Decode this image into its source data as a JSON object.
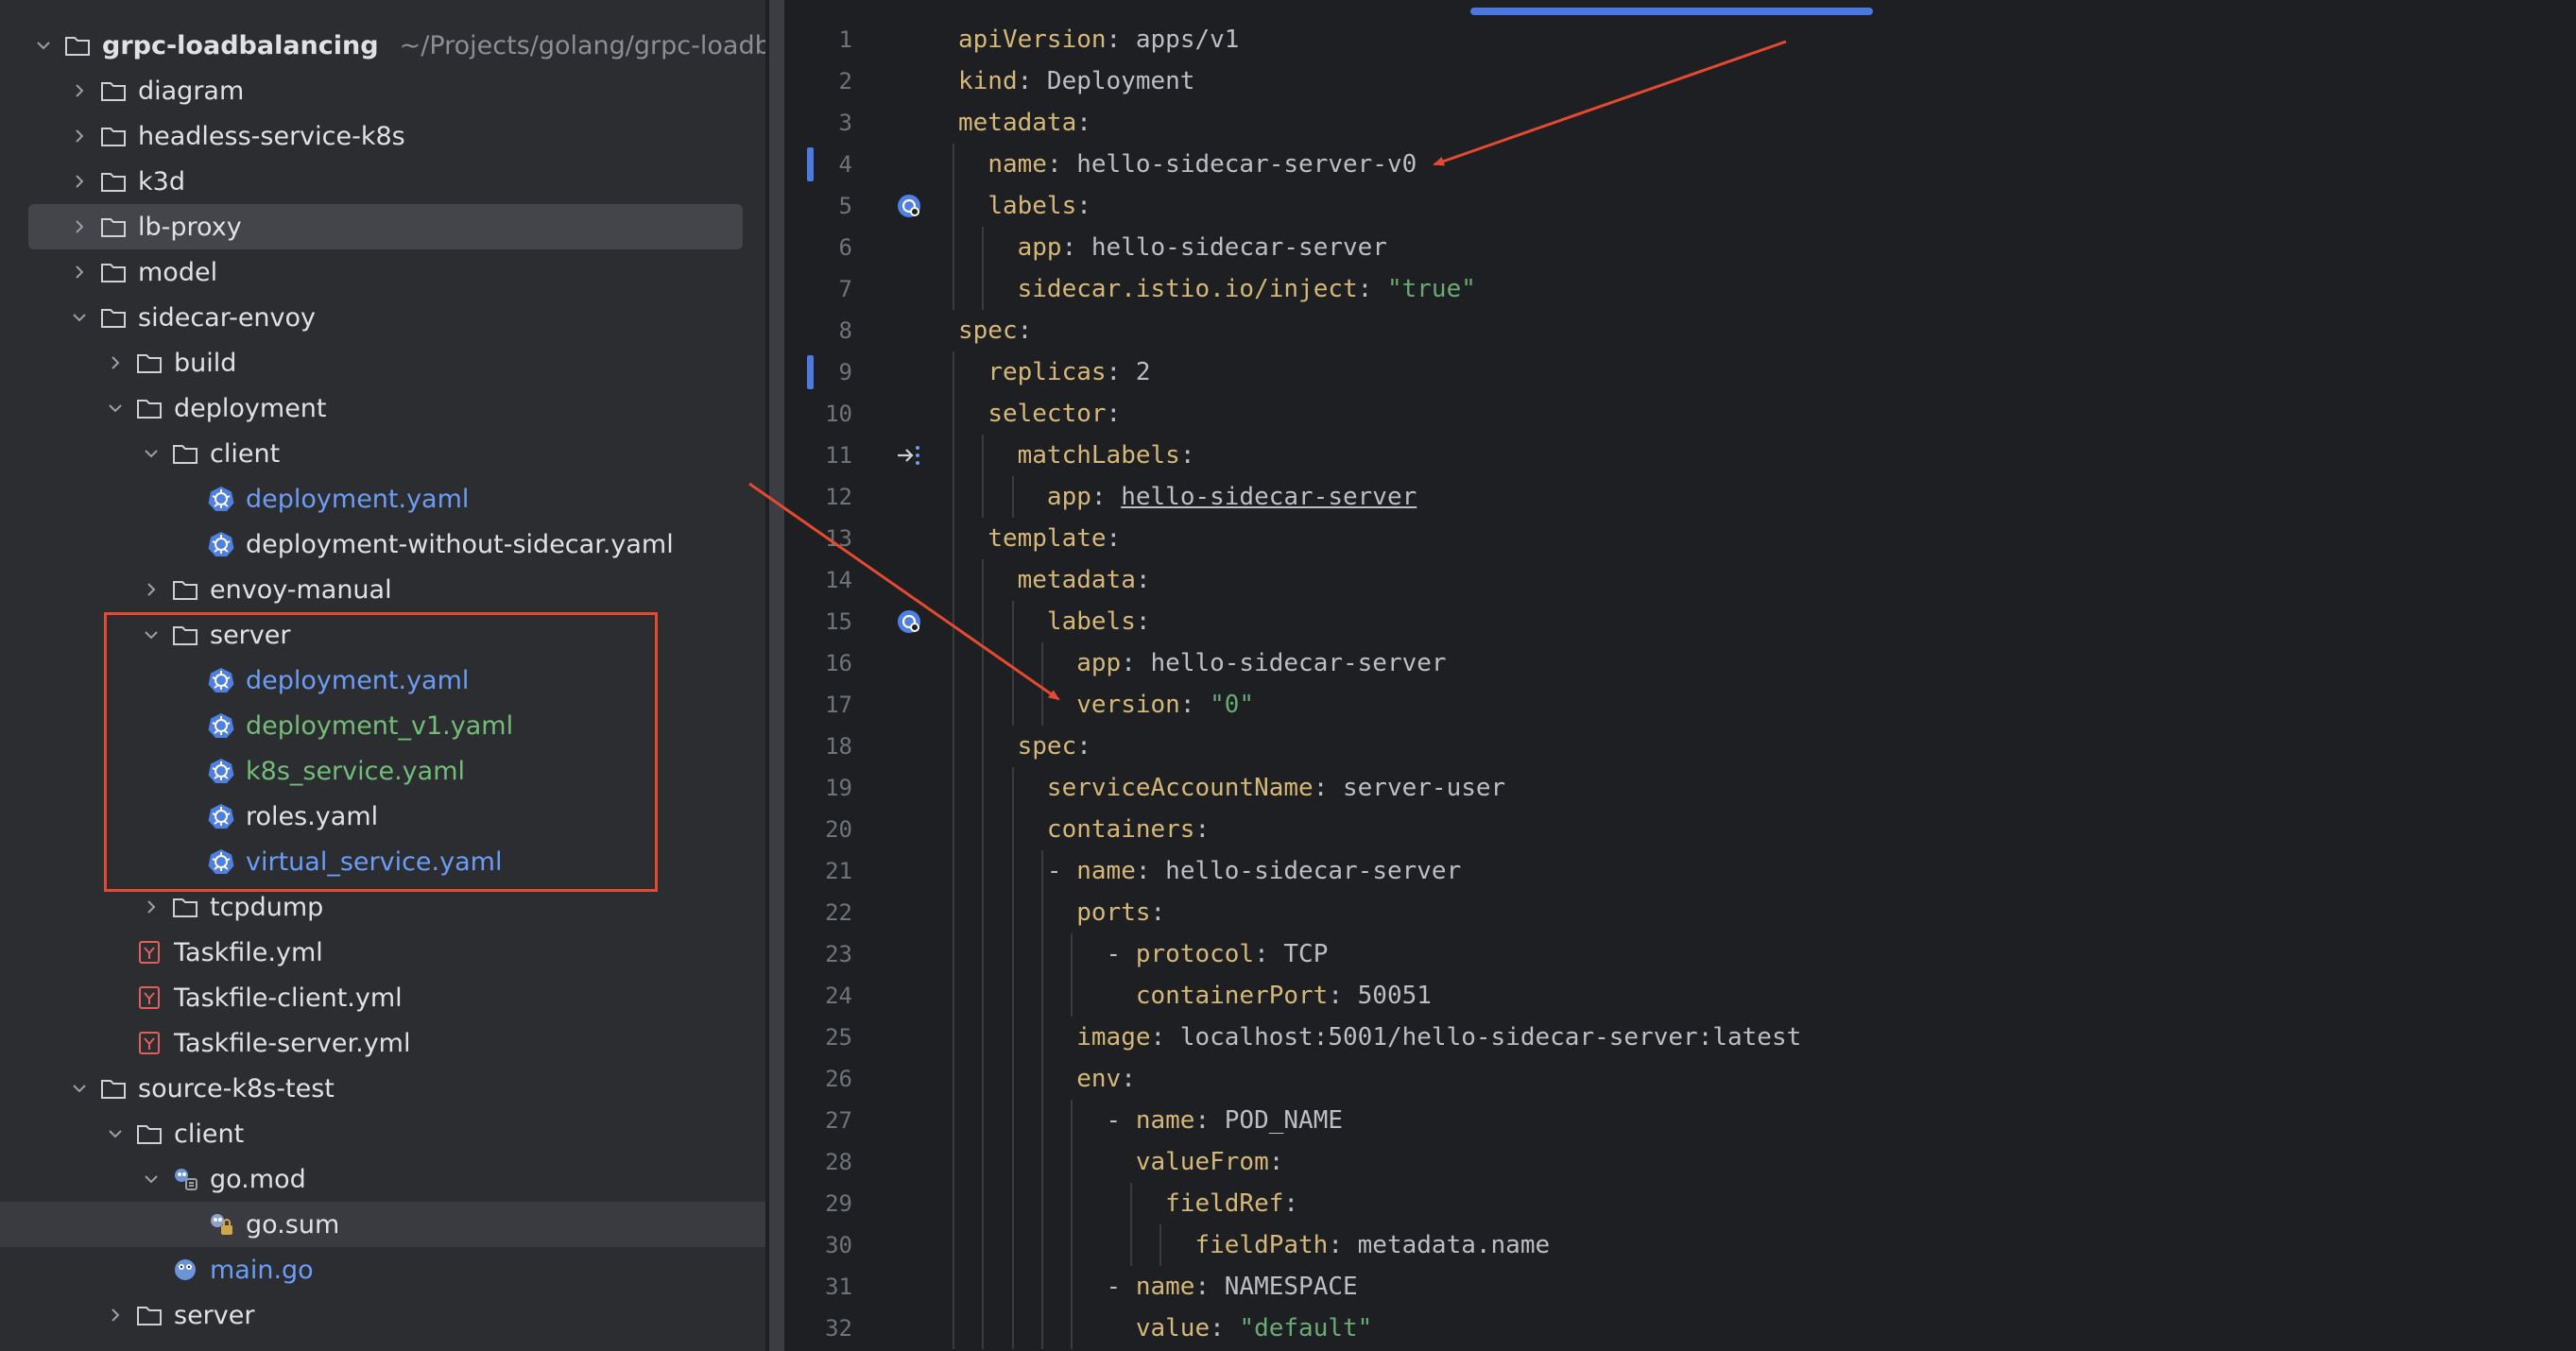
{
  "project_tree": {
    "root": {
      "name": "grpc-loadbalancing",
      "path": "~/Projects/golang/grpc-loadbalan"
    },
    "items": [
      {
        "label": "diagram",
        "depth": 1,
        "type": "folder",
        "expanded": false
      },
      {
        "label": "headless-service-k8s",
        "depth": 1,
        "type": "folder",
        "expanded": false
      },
      {
        "label": "k3d",
        "depth": 1,
        "type": "folder",
        "expanded": false
      },
      {
        "label": "lb-proxy",
        "depth": 1,
        "type": "folder",
        "expanded": false,
        "selected": true
      },
      {
        "label": "model",
        "depth": 1,
        "type": "folder",
        "expanded": false
      },
      {
        "label": "sidecar-envoy",
        "depth": 1,
        "type": "folder",
        "expanded": true
      },
      {
        "label": "build",
        "depth": 2,
        "type": "folder",
        "expanded": false
      },
      {
        "label": "deployment",
        "depth": 2,
        "type": "folder",
        "expanded": true
      },
      {
        "label": "client",
        "depth": 3,
        "type": "folder",
        "expanded": true
      },
      {
        "label": "deployment.yaml",
        "depth": 4,
        "type": "k8s",
        "color": "blue"
      },
      {
        "label": "deployment-without-sidecar.yaml",
        "depth": 4,
        "type": "k8s"
      },
      {
        "label": "envoy-manual",
        "depth": 3,
        "type": "folder",
        "expanded": false
      },
      {
        "label": "server",
        "depth": 3,
        "type": "folder",
        "expanded": true
      },
      {
        "label": "deployment.yaml",
        "depth": 4,
        "type": "k8s",
        "color": "blue"
      },
      {
        "label": "deployment_v1.yaml",
        "depth": 4,
        "type": "k8s",
        "color": "green"
      },
      {
        "label": "k8s_service.yaml",
        "depth": 4,
        "type": "k8s",
        "color": "green"
      },
      {
        "label": "roles.yaml",
        "depth": 4,
        "type": "k8s"
      },
      {
        "label": "virtual_service.yaml",
        "depth": 4,
        "type": "k8s",
        "color": "blue"
      },
      {
        "label": "tcpdump",
        "depth": 3,
        "type": "folder",
        "expanded": false
      },
      {
        "label": "Taskfile.yml",
        "depth": 2,
        "type": "yml"
      },
      {
        "label": "Taskfile-client.yml",
        "depth": 2,
        "type": "yml"
      },
      {
        "label": "Taskfile-server.yml",
        "depth": 2,
        "type": "yml"
      },
      {
        "label": "source-k8s-test",
        "depth": 1,
        "type": "folder",
        "expanded": true
      },
      {
        "label": "client",
        "depth": 2,
        "type": "folder",
        "expanded": true
      },
      {
        "label": "go.mod",
        "depth": 3,
        "type": "gomod",
        "expanded": true
      },
      {
        "label": "go.sum",
        "depth": 4,
        "type": "gosum",
        "hover": true
      },
      {
        "label": "main.go",
        "depth": 3,
        "type": "go",
        "color": "blue"
      },
      {
        "label": "server",
        "depth": 2,
        "type": "folder",
        "expanded": false
      }
    ]
  },
  "editor": {
    "first_line_number": 1,
    "lines": [
      [
        [
          "k",
          "apiVersion"
        ],
        [
          "p",
          ": apps/v1"
        ]
      ],
      [
        [
          "k",
          "kind"
        ],
        [
          "p",
          ": Deployment"
        ]
      ],
      [
        [
          "k",
          "metadata"
        ],
        [
          "p",
          ":"
        ]
      ],
      [
        [
          "p",
          "  "
        ],
        [
          "k",
          "name"
        ],
        [
          "p",
          ": hello-sidecar-server-v0"
        ]
      ],
      [
        [
          "p",
          "  "
        ],
        [
          "k",
          "labels"
        ],
        [
          "p",
          ":"
        ]
      ],
      [
        [
          "p",
          "    "
        ],
        [
          "k",
          "app"
        ],
        [
          "p",
          ": hello-sidecar-server"
        ]
      ],
      [
        [
          "p",
          "    "
        ],
        [
          "k",
          "sidecar.istio.io/inject"
        ],
        [
          "p",
          ": "
        ],
        [
          "s",
          "\"true\""
        ]
      ],
      [
        [
          "k",
          "spec"
        ],
        [
          "p",
          ":"
        ]
      ],
      [
        [
          "p",
          "  "
        ],
        [
          "k",
          "replicas"
        ],
        [
          "p",
          ": 2"
        ]
      ],
      [
        [
          "p",
          "  "
        ],
        [
          "k",
          "selector"
        ],
        [
          "p",
          ":"
        ]
      ],
      [
        [
          "p",
          "    "
        ],
        [
          "k",
          "matchLabels"
        ],
        [
          "p",
          ":"
        ]
      ],
      [
        [
          "p",
          "      "
        ],
        [
          "k",
          "app"
        ],
        [
          "p",
          ": "
        ],
        [
          "u",
          "hello-sidecar-server"
        ]
      ],
      [
        [
          "p",
          "  "
        ],
        [
          "k",
          "template"
        ],
        [
          "p",
          ":"
        ]
      ],
      [
        [
          "p",
          "    "
        ],
        [
          "k",
          "metadata"
        ],
        [
          "p",
          ":"
        ]
      ],
      [
        [
          "p",
          "      "
        ],
        [
          "k",
          "labels"
        ],
        [
          "p",
          ":"
        ]
      ],
      [
        [
          "p",
          "        "
        ],
        [
          "k",
          "app"
        ],
        [
          "p",
          ": hello-sidecar-server"
        ]
      ],
      [
        [
          "p",
          "        "
        ],
        [
          "k",
          "version"
        ],
        [
          "p",
          ": "
        ],
        [
          "s",
          "\"0\""
        ]
      ],
      [
        [
          "p",
          "    "
        ],
        [
          "k",
          "spec"
        ],
        [
          "p",
          ":"
        ]
      ],
      [
        [
          "p",
          "      "
        ],
        [
          "k",
          "serviceAccountName"
        ],
        [
          "p",
          ": server-user"
        ]
      ],
      [
        [
          "p",
          "      "
        ],
        [
          "k",
          "containers"
        ],
        [
          "p",
          ":"
        ]
      ],
      [
        [
          "p",
          "      - "
        ],
        [
          "k",
          "name"
        ],
        [
          "p",
          ": hello-sidecar-server"
        ]
      ],
      [
        [
          "p",
          "        "
        ],
        [
          "k",
          "ports"
        ],
        [
          "p",
          ":"
        ]
      ],
      [
        [
          "p",
          "          - "
        ],
        [
          "k",
          "protocol"
        ],
        [
          "p",
          ": TCP"
        ]
      ],
      [
        [
          "p",
          "            "
        ],
        [
          "k",
          "containerPort"
        ],
        [
          "p",
          ": 50051"
        ]
      ],
      [
        [
          "p",
          "        "
        ],
        [
          "k",
          "image"
        ],
        [
          "p",
          ": localhost:5001/hello-sidecar-server:latest"
        ]
      ],
      [
        [
          "p",
          "        "
        ],
        [
          "k",
          "env"
        ],
        [
          "p",
          ":"
        ]
      ],
      [
        [
          "p",
          "          - "
        ],
        [
          "k",
          "name"
        ],
        [
          "p",
          ": POD_NAME"
        ]
      ],
      [
        [
          "p",
          "            "
        ],
        [
          "k",
          "valueFrom"
        ],
        [
          "p",
          ":"
        ]
      ],
      [
        [
          "p",
          "              "
        ],
        [
          "k",
          "fieldRef"
        ],
        [
          "p",
          ":"
        ]
      ],
      [
        [
          "p",
          "                "
        ],
        [
          "k",
          "fieldPath"
        ],
        [
          "p",
          ": metadata.name"
        ]
      ],
      [
        [
          "p",
          "          - "
        ],
        [
          "k",
          "name"
        ],
        [
          "p",
          ": NAMESPACE"
        ]
      ],
      [
        [
          "p",
          "            "
        ],
        [
          "k",
          "value"
        ],
        [
          "p",
          ": "
        ],
        [
          "s",
          "\"default\""
        ]
      ]
    ],
    "changed_lines": [
      4,
      9
    ],
    "gutter_icons": [
      {
        "line": 5,
        "icon": "k8s-resource-icon"
      },
      {
        "line": 11,
        "icon": "selector-navigate-icon"
      },
      {
        "line": 15,
        "icon": "k8s-resource-icon"
      }
    ]
  },
  "annotations": {
    "color": "#e5492f"
  },
  "theme": {
    "accent": "#4c7ae0",
    "key": "#d5b778",
    "string": "#6aab73",
    "blue_file": "#6b9df6",
    "green_file": "#73bd79"
  }
}
